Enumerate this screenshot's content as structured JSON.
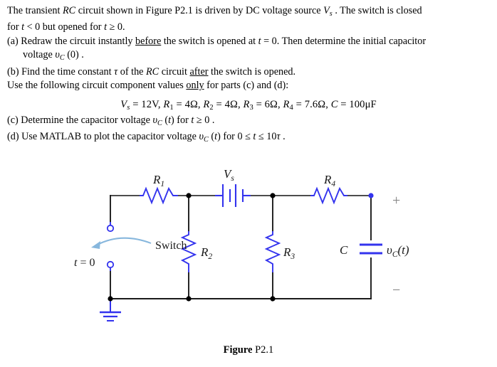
{
  "document": {
    "type": "textbook-problem",
    "figure_label": "Figure P2.1"
  },
  "problem": {
    "intro_1": "The transient ",
    "intro_rc": "RC",
    "intro_2": " circuit shown in Figure P2.1 is driven by DC voltage source ",
    "intro_vs": "V",
    "intro_vs_sub": "s",
    "intro_3": " . The switch is closed",
    "line2_a": "for ",
    "line2_t": "t",
    "line2_b": " < 0 but opened for ",
    "line2_t2": "t",
    "line2_c": " ≥ 0.",
    "part_a": {
      "marker": "(a)",
      "text_1": " Redraw the circuit instantly ",
      "underlined": "before",
      "text_2": " the switch is opened at ",
      "t_var": "t",
      "text_3": " = 0. Then determine the initial capacitor",
      "line2_1": "voltage ",
      "line2_v": "υ",
      "line2_sub": "C",
      "line2_2": " (0) ."
    },
    "part_b": {
      "marker": "(b)",
      "text_1": " Find the time constant ",
      "tau": "τ",
      "text_2": " of the ",
      "rc": "RC",
      "text_3": " circuit ",
      "underlined": "after",
      "text_4": " the switch is opened."
    },
    "values_intro": {
      "text_1": "Use the following circuit component values ",
      "underlined": "only",
      "text_2": " for parts (c) and (d):"
    },
    "part_c": {
      "marker": "(c)",
      "text_1": " Determine the capacitor voltage ",
      "v": "υ",
      "v_sub": "C",
      "text_2": " (",
      "t": "t",
      "text_3": ") for ",
      "t2": "t",
      "text_4": " ≥ 0 ."
    },
    "part_d": {
      "marker": "(d)",
      "text_1": " Use MATLAB to plot the capacitor voltage ",
      "v": "υ",
      "v_sub": "C",
      "text_2": " (",
      "t": "t",
      "text_3": ") for 0 ≤ ",
      "t2": "t",
      "text_4": " ≤ 10",
      "tau": "τ",
      "text_5": " ."
    }
  },
  "component_values": {
    "full_line": "V_s = 12V, R_1 = 4Ω, R_2 = 4Ω, R_3 = 6Ω, R_4 = 7.6Ω, C = 100μF",
    "items": [
      {
        "symbol": "V",
        "subscript": "s",
        "value": "12V"
      },
      {
        "symbol": "R",
        "subscript": "1",
        "value": "4Ω"
      },
      {
        "symbol": "R",
        "subscript": "2",
        "value": "4Ω"
      },
      {
        "symbol": "R",
        "subscript": "3",
        "value": "6Ω"
      },
      {
        "symbol": "R",
        "subscript": "4",
        "value": "7.6Ω"
      },
      {
        "symbol": "C",
        "subscript": "",
        "value": "100μF"
      }
    ],
    "Vs": "12V",
    "R1": "4Ω",
    "R2": "4Ω",
    "R3": "6Ω",
    "R4": "7.6Ω",
    "C": "100μF"
  },
  "circuit": {
    "colors": {
      "component": "#3333ee",
      "wire": "#4d4d4d",
      "wire_dark": "#1a1a1a",
      "node": "#000000",
      "label": "#1a1a1a",
      "sign": "#808080"
    },
    "labels": {
      "r1": {
        "symbol": "R",
        "subscript": "1"
      },
      "r2": {
        "symbol": "R",
        "subscript": "2"
      },
      "r3": {
        "symbol": "R",
        "subscript": "3"
      },
      "r4": {
        "symbol": "R",
        "subscript": "4"
      },
      "vs": {
        "symbol": "V",
        "subscript": "s"
      },
      "c": {
        "symbol": "C",
        "subscript": ""
      },
      "vc": {
        "symbol": "υ",
        "subscript": "C",
        "suffix": "(t)"
      },
      "switch": "Switch",
      "t_zero": {
        "symbol": "t",
        "text": " = 0"
      },
      "plus": "+",
      "minus": "−"
    },
    "elements": [
      {
        "name": "resistor-r1",
        "orientation": "horizontal"
      },
      {
        "name": "resistor-r2",
        "orientation": "vertical"
      },
      {
        "name": "resistor-r3",
        "orientation": "vertical"
      },
      {
        "name": "resistor-r4",
        "orientation": "horizontal"
      },
      {
        "name": "voltage-source-vs",
        "orientation": "horizontal"
      },
      {
        "name": "capacitor-c",
        "orientation": "vertical"
      },
      {
        "name": "switch",
        "orientation": "vertical",
        "state": "open"
      },
      {
        "name": "ground",
        "orientation": "vertical"
      }
    ]
  },
  "caption": {
    "bold_part": "Figure",
    "rest": " P2.1"
  }
}
